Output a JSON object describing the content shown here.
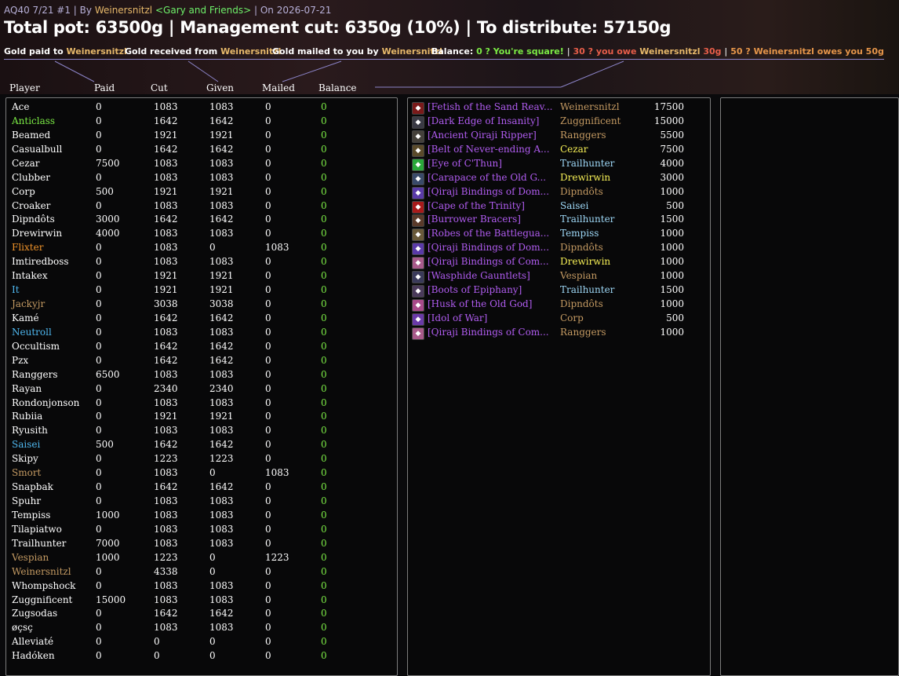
{
  "header": {
    "title_prefix": "AQ40 7/21 #1 | By",
    "author": "Weinersnitzl",
    "guild": "<Gary and Friends>",
    "date_text": "| On 2026-07-21",
    "summary": "Total pot: 63500g | Management cut: 6350g (10%) | To distribute: 57150g"
  },
  "legend": {
    "paid_label": "Gold paid to",
    "received_label": "Gold received from",
    "mailed_label": "Gold mailed to you by",
    "name": "Weinersnitzl",
    "balance_label": "Balance:",
    "square": "0 ? You're square!",
    "owe_prefix": "30 ? you owe",
    "owe_suffix": "30g",
    "owes_prefix": "50 ? Weinersnitzl owes you 50g",
    "separator": "|"
  },
  "columns": [
    "Player",
    "Paid",
    "Cut",
    "Given",
    "Mailed",
    "Balance"
  ],
  "colors": {
    "white": "#ffffff",
    "green": "#7bea45",
    "orange": "#f0932a",
    "blue": "#4fb8f0",
    "tan": "#c49a62",
    "purple": "#b05cf0",
    "pink": "#f08cc8",
    "yellow": "#f7f056",
    "lightblue": "#9ed8f7"
  },
  "players": [
    {
      "name": "Ace",
      "color": "white",
      "paid": "0",
      "cut": "1083",
      "given": "1083",
      "mailed": "0",
      "balance": "0"
    },
    {
      "name": "Anticlass",
      "color": "green",
      "paid": "0",
      "cut": "1642",
      "given": "1642",
      "mailed": "0",
      "balance": "0"
    },
    {
      "name": "Beamed",
      "color": "white",
      "paid": "0",
      "cut": "1921",
      "given": "1921",
      "mailed": "0",
      "balance": "0"
    },
    {
      "name": "Casualbull",
      "color": "white",
      "paid": "0",
      "cut": "1642",
      "given": "1642",
      "mailed": "0",
      "balance": "0"
    },
    {
      "name": "Cezar",
      "color": "white",
      "paid": "7500",
      "cut": "1083",
      "given": "1083",
      "mailed": "0",
      "balance": "0"
    },
    {
      "name": "Clubber",
      "color": "white",
      "paid": "0",
      "cut": "1083",
      "given": "1083",
      "mailed": "0",
      "balance": "0"
    },
    {
      "name": "Corp",
      "color": "white",
      "paid": "500",
      "cut": "1921",
      "given": "1921",
      "mailed": "0",
      "balance": "0"
    },
    {
      "name": "Croaker",
      "color": "white",
      "paid": "0",
      "cut": "1083",
      "given": "1083",
      "mailed": "0",
      "balance": "0"
    },
    {
      "name": "Dipndôts",
      "color": "white",
      "paid": "3000",
      "cut": "1642",
      "given": "1642",
      "mailed": "0",
      "balance": "0"
    },
    {
      "name": "Drewirwin",
      "color": "white",
      "paid": "4000",
      "cut": "1083",
      "given": "1083",
      "mailed": "0",
      "balance": "0"
    },
    {
      "name": "Flixter",
      "color": "orange",
      "paid": "0",
      "cut": "1083",
      "given": "0",
      "mailed": "1083",
      "balance": "0"
    },
    {
      "name": "Imtiredboss",
      "color": "white",
      "paid": "0",
      "cut": "1083",
      "given": "1083",
      "mailed": "0",
      "balance": "0"
    },
    {
      "name": "Intakex",
      "color": "white",
      "paid": "0",
      "cut": "1921",
      "given": "1921",
      "mailed": "0",
      "balance": "0"
    },
    {
      "name": "It",
      "color": "blue",
      "paid": "0",
      "cut": "1921",
      "given": "1921",
      "mailed": "0",
      "balance": "0"
    },
    {
      "name": "Jackyjr",
      "color": "tan",
      "paid": "0",
      "cut": "3038",
      "given": "3038",
      "mailed": "0",
      "balance": "0"
    },
    {
      "name": "Kamé",
      "color": "white",
      "paid": "0",
      "cut": "1642",
      "given": "1642",
      "mailed": "0",
      "balance": "0"
    },
    {
      "name": "Neutroll",
      "color": "blue",
      "paid": "0",
      "cut": "1083",
      "given": "1083",
      "mailed": "0",
      "balance": "0"
    },
    {
      "name": "Occultism",
      "color": "white",
      "paid": "0",
      "cut": "1642",
      "given": "1642",
      "mailed": "0",
      "balance": "0"
    },
    {
      "name": "Pzx",
      "color": "white",
      "paid": "0",
      "cut": "1642",
      "given": "1642",
      "mailed": "0",
      "balance": "0"
    },
    {
      "name": "Ranggers",
      "color": "white",
      "paid": "6500",
      "cut": "1083",
      "given": "1083",
      "mailed": "0",
      "balance": "0"
    },
    {
      "name": "Rayan",
      "color": "white",
      "paid": "0",
      "cut": "2340",
      "given": "2340",
      "mailed": "0",
      "balance": "0"
    },
    {
      "name": "Rondonjonson",
      "color": "white",
      "paid": "0",
      "cut": "1083",
      "given": "1083",
      "mailed": "0",
      "balance": "0"
    },
    {
      "name": "Rubiia",
      "color": "white",
      "paid": "0",
      "cut": "1921",
      "given": "1921",
      "mailed": "0",
      "balance": "0"
    },
    {
      "name": "Ryusith",
      "color": "white",
      "paid": "0",
      "cut": "1083",
      "given": "1083",
      "mailed": "0",
      "balance": "0"
    },
    {
      "name": "Saisei",
      "color": "blue",
      "paid": "500",
      "cut": "1642",
      "given": "1642",
      "mailed": "0",
      "balance": "0"
    },
    {
      "name": "Skipy",
      "color": "white",
      "paid": "0",
      "cut": "1223",
      "given": "1223",
      "mailed": "0",
      "balance": "0"
    },
    {
      "name": "Smort",
      "color": "tan",
      "paid": "0",
      "cut": "1083",
      "given": "0",
      "mailed": "1083",
      "balance": "0"
    },
    {
      "name": "Snapbak",
      "color": "white",
      "paid": "0",
      "cut": "1642",
      "given": "1642",
      "mailed": "0",
      "balance": "0"
    },
    {
      "name": "Spuhr",
      "color": "white",
      "paid": "0",
      "cut": "1083",
      "given": "1083",
      "mailed": "0",
      "balance": "0"
    },
    {
      "name": "Tempiss",
      "color": "white",
      "paid": "1000",
      "cut": "1083",
      "given": "1083",
      "mailed": "0",
      "balance": "0"
    },
    {
      "name": "Tilapiatwo",
      "color": "white",
      "paid": "0",
      "cut": "1083",
      "given": "1083",
      "mailed": "0",
      "balance": "0"
    },
    {
      "name": "Trailhunter",
      "color": "white",
      "paid": "7000",
      "cut": "1083",
      "given": "1083",
      "mailed": "0",
      "balance": "0"
    },
    {
      "name": "Vespian",
      "color": "tan",
      "paid": "1000",
      "cut": "1223",
      "given": "0",
      "mailed": "1223",
      "balance": "0"
    },
    {
      "name": "Weinersnitzl",
      "color": "tan",
      "paid": "0",
      "cut": "4338",
      "given": "0",
      "mailed": "0",
      "balance": "0"
    },
    {
      "name": "Whompshock",
      "color": "white",
      "paid": "0",
      "cut": "1083",
      "given": "1083",
      "mailed": "0",
      "balance": "0"
    },
    {
      "name": "Zuggnificent",
      "color": "white",
      "paid": "15000",
      "cut": "1083",
      "given": "1083",
      "mailed": "0",
      "balance": "0"
    },
    {
      "name": "Zugsodas",
      "color": "white",
      "paid": "0",
      "cut": "1642",
      "given": "1642",
      "mailed": "0",
      "balance": "0"
    },
    {
      "name": "øçsç",
      "color": "white",
      "paid": "0",
      "cut": "1083",
      "given": "1083",
      "mailed": "0",
      "balance": "0"
    },
    {
      "name": "Alleviaté",
      "color": "white",
      "paid": "0",
      "cut": "0",
      "given": "0",
      "mailed": "0",
      "balance": "0"
    },
    {
      "name": "Hadóken",
      "color": "white",
      "paid": "0",
      "cut": "0",
      "given": "0",
      "mailed": "0",
      "balance": "0"
    }
  ],
  "items": [
    {
      "name": "[Fetish of the Sand Reav...",
      "winner": "Weinersnitzl",
      "winner_color": "tan",
      "amount": "17500",
      "icon": "fetish-icon",
      "icon_color": "#7a1a1a"
    },
    {
      "name": "[Dark Edge of Insanity]",
      "winner": "Zuggnificent",
      "winner_color": "tan",
      "amount": "15000",
      "icon": "axe-icon",
      "icon_color": "#3a3a44"
    },
    {
      "name": "[Ancient Qiraji Ripper]",
      "winner": "Ranggers",
      "winner_color": "tan",
      "amount": "5500",
      "icon": "sword-icon",
      "icon_color": "#44403a"
    },
    {
      "name": "[Belt of Never-ending A...",
      "winner": "Cezar",
      "winner_color": "yellow",
      "amount": "7500",
      "icon": "belt-icon",
      "icon_color": "#5a4a2a"
    },
    {
      "name": "[Eye of C'Thun]",
      "winner": "Trailhunter",
      "winner_color": "lightblue",
      "amount": "4000",
      "icon": "eye-icon",
      "icon_color": "#2aa83a"
    },
    {
      "name": "[Carapace of the Old G...",
      "winner": "Drewirwin",
      "winner_color": "yellow",
      "amount": "3000",
      "icon": "chest-icon",
      "icon_color": "#3a4a6a"
    },
    {
      "name": "[Qiraji Bindings of Dom...",
      "winner": "Dipndôts",
      "winner_color": "tan",
      "amount": "1000",
      "icon": "bindings-icon",
      "icon_color": "#5a3aa8"
    },
    {
      "name": "[Cape of the Trinity]",
      "winner": "Saisei",
      "winner_color": "lightblue",
      "amount": "500",
      "icon": "cape-icon",
      "icon_color": "#a81a1a"
    },
    {
      "name": "[Burrower Bracers]",
      "winner": "Trailhunter",
      "winner_color": "lightblue",
      "amount": "1500",
      "icon": "bracers-icon",
      "icon_color": "#5a3a2a"
    },
    {
      "name": "[Robes of the Battlegua...",
      "winner": "Tempiss",
      "winner_color": "lightblue",
      "amount": "1000",
      "icon": "robe-icon",
      "icon_color": "#6a5a3a"
    },
    {
      "name": "[Qiraji Bindings of Dom...",
      "winner": "Dipndôts",
      "winner_color": "tan",
      "amount": "1000",
      "icon": "bindings-icon",
      "icon_color": "#5a3aa8"
    },
    {
      "name": "[Qiraji Bindings of Com...",
      "winner": "Drewirwin",
      "winner_color": "yellow",
      "amount": "1000",
      "icon": "bindings-icon",
      "icon_color": "#a85a8a"
    },
    {
      "name": "[Wasphide Gauntlets]",
      "winner": "Vespian",
      "winner_color": "tan",
      "amount": "1000",
      "icon": "gauntlets-icon",
      "icon_color": "#3a3a5a"
    },
    {
      "name": "[Boots of Epiphany]",
      "winner": "Trailhunter",
      "winner_color": "lightblue",
      "amount": "1500",
      "icon": "boots-icon",
      "icon_color": "#4a3a5a"
    },
    {
      "name": "[Husk of the Old God]",
      "winner": "Dipndôts",
      "winner_color": "tan",
      "amount": "1000",
      "icon": "husk-icon",
      "icon_color": "#a84a8a"
    },
    {
      "name": "[Idol of War]",
      "winner": "Corp",
      "winner_color": "tan",
      "amount": "500",
      "icon": "idol-icon",
      "icon_color": "#6a3aa8"
    },
    {
      "name": "[Qiraji Bindings of Com...",
      "winner": "Ranggers",
      "winner_color": "tan",
      "amount": "1000",
      "icon": "bindings-icon",
      "icon_color": "#a85a8a"
    }
  ]
}
